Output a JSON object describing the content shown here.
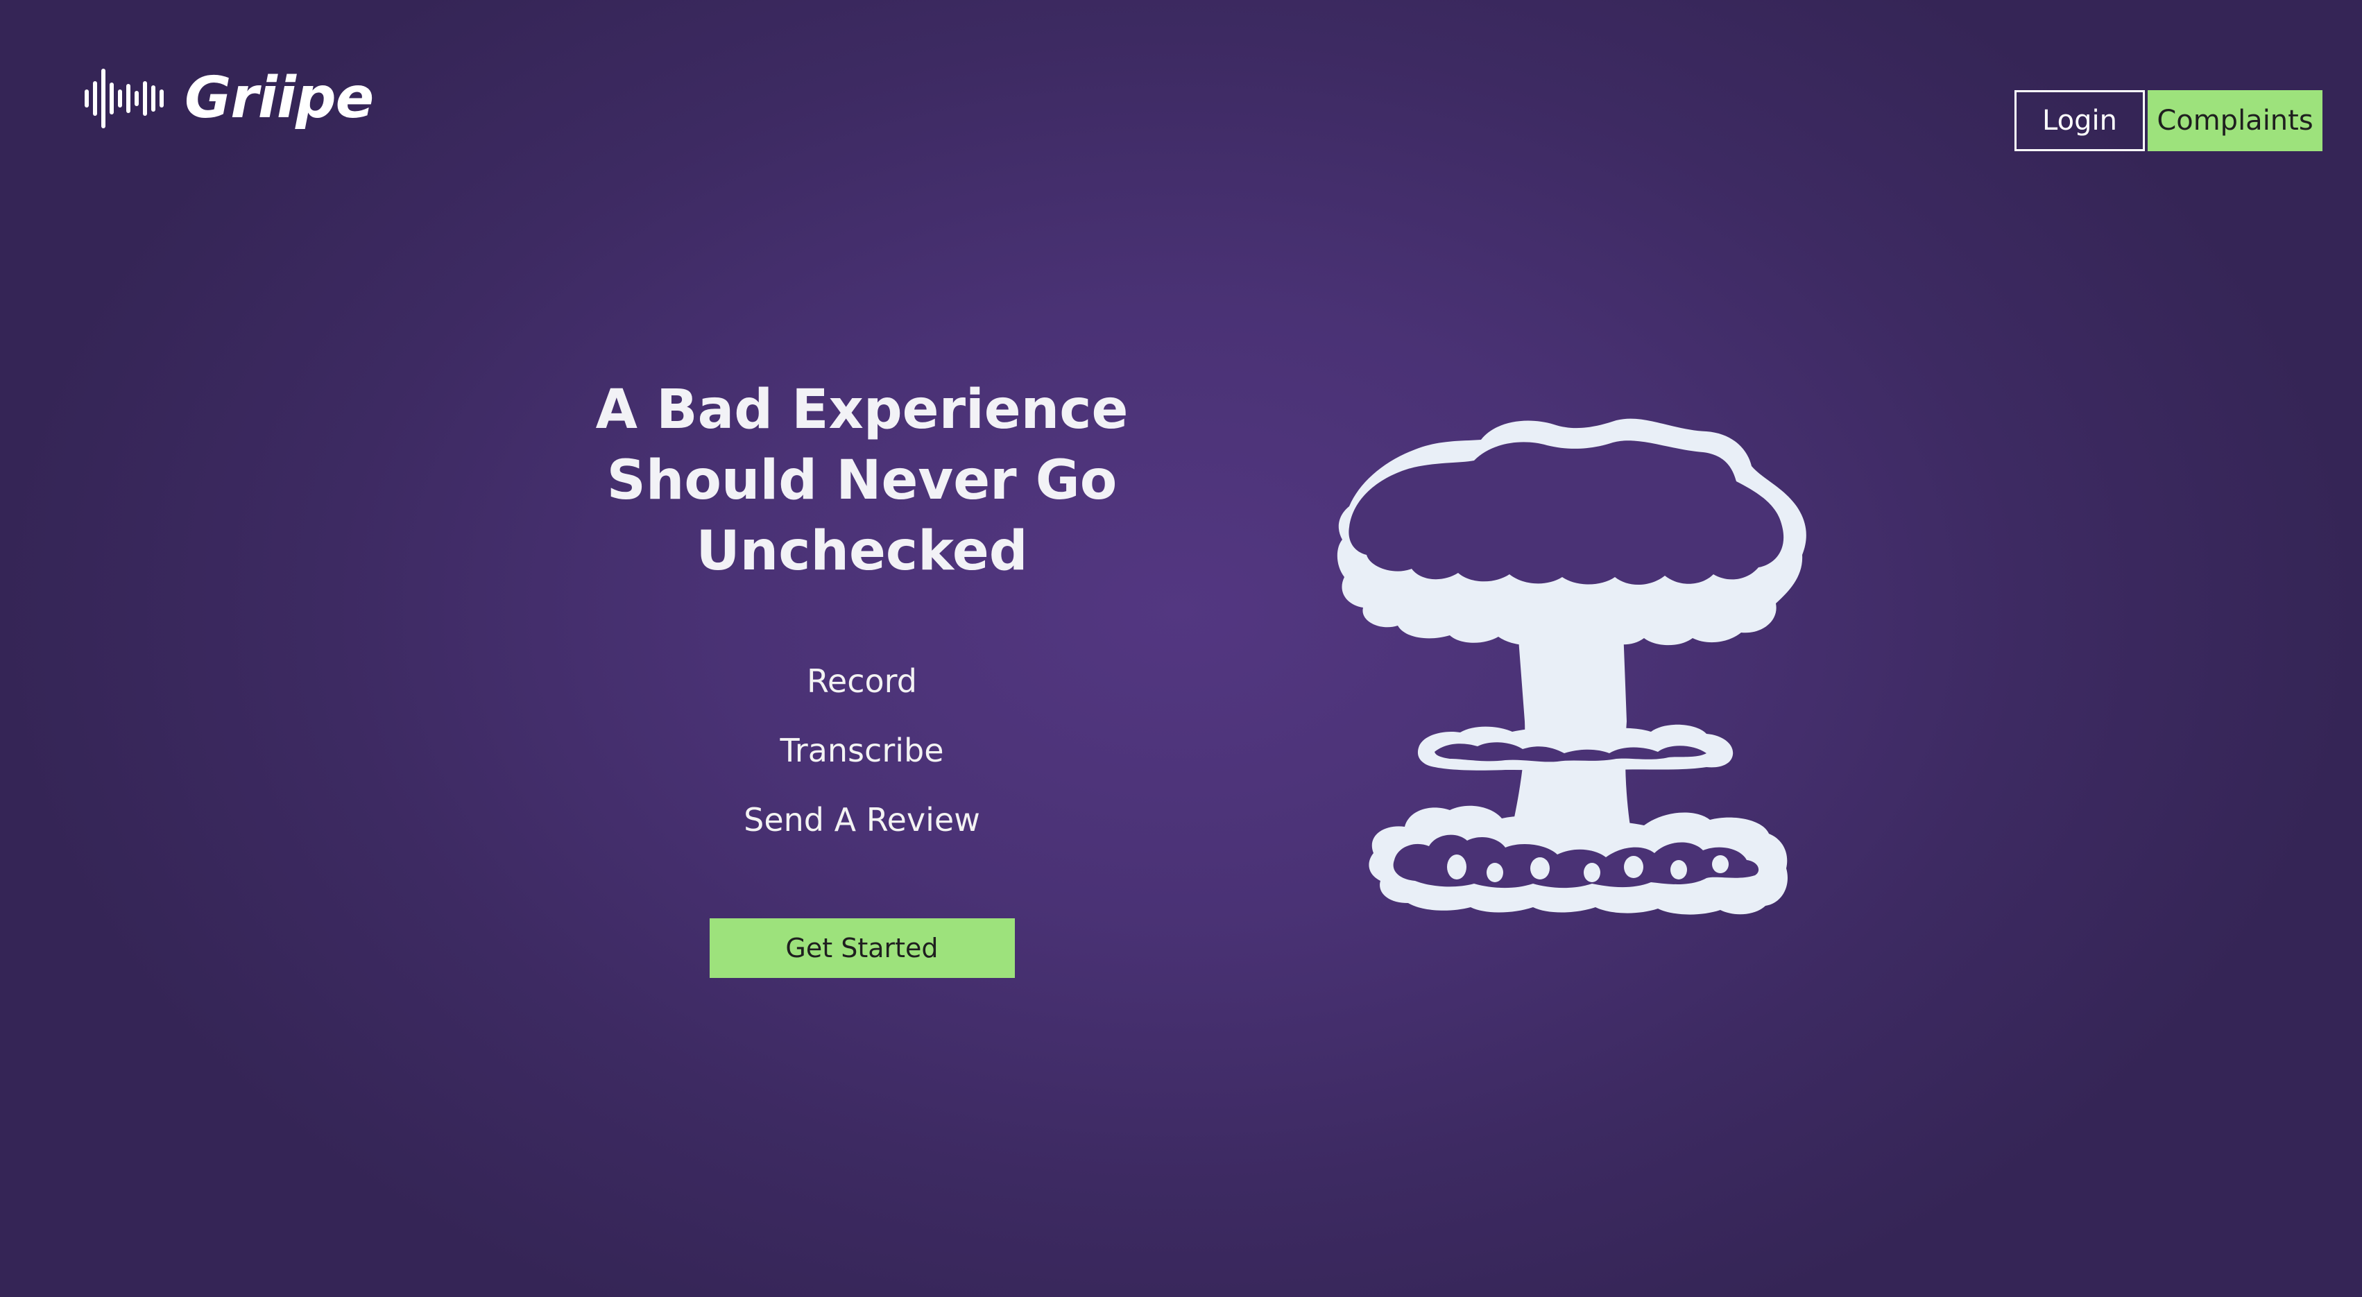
{
  "brand": {
    "name": "Griipe",
    "icon": "sound-wave-icon"
  },
  "nav": {
    "login_label": "Login",
    "complaints_label": "Complaints"
  },
  "hero": {
    "headline_lines": [
      "A Bad Experience",
      "Should Never Go",
      "Unchecked"
    ],
    "features": [
      "Record",
      "Transcribe",
      "Send A Review"
    ],
    "cta_label": "Get Started",
    "illustration": "mushroom-cloud-icon"
  },
  "colors": {
    "background": "#4a3275",
    "accent_green": "#9de27c",
    "illustration_fill": "#e9eff7"
  }
}
